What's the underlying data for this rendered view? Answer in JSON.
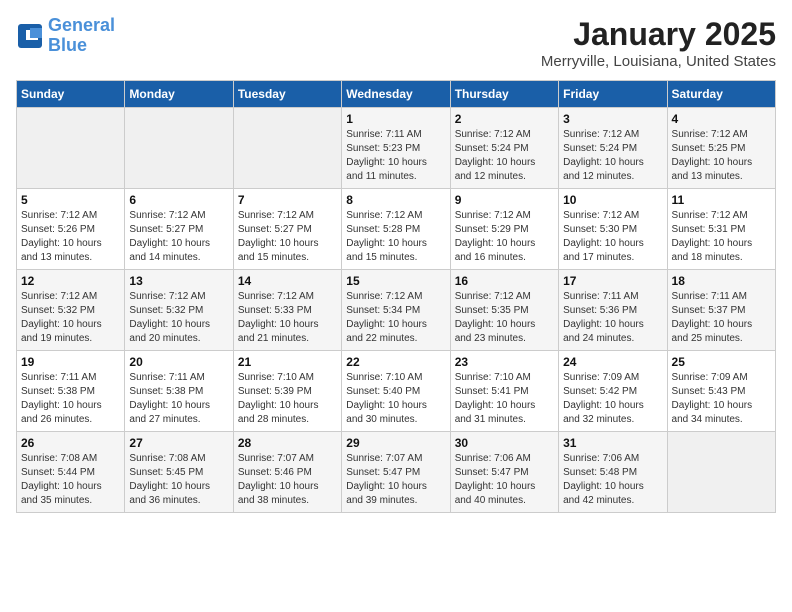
{
  "logo": {
    "text_general": "General",
    "text_blue": "Blue"
  },
  "title": "January 2025",
  "subtitle": "Merryville, Louisiana, United States",
  "days_of_week": [
    "Sunday",
    "Monday",
    "Tuesday",
    "Wednesday",
    "Thursday",
    "Friday",
    "Saturday"
  ],
  "weeks": [
    [
      {
        "day": "",
        "sunrise": "",
        "sunset": "",
        "daylight": ""
      },
      {
        "day": "",
        "sunrise": "",
        "sunset": "",
        "daylight": ""
      },
      {
        "day": "",
        "sunrise": "",
        "sunset": "",
        "daylight": ""
      },
      {
        "day": "1",
        "sunrise": "Sunrise: 7:11 AM",
        "sunset": "Sunset: 5:23 PM",
        "daylight": "Daylight: 10 hours and 11 minutes."
      },
      {
        "day": "2",
        "sunrise": "Sunrise: 7:12 AM",
        "sunset": "Sunset: 5:24 PM",
        "daylight": "Daylight: 10 hours and 12 minutes."
      },
      {
        "day": "3",
        "sunrise": "Sunrise: 7:12 AM",
        "sunset": "Sunset: 5:24 PM",
        "daylight": "Daylight: 10 hours and 12 minutes."
      },
      {
        "day": "4",
        "sunrise": "Sunrise: 7:12 AM",
        "sunset": "Sunset: 5:25 PM",
        "daylight": "Daylight: 10 hours and 13 minutes."
      }
    ],
    [
      {
        "day": "5",
        "sunrise": "Sunrise: 7:12 AM",
        "sunset": "Sunset: 5:26 PM",
        "daylight": "Daylight: 10 hours and 13 minutes."
      },
      {
        "day": "6",
        "sunrise": "Sunrise: 7:12 AM",
        "sunset": "Sunset: 5:27 PM",
        "daylight": "Daylight: 10 hours and 14 minutes."
      },
      {
        "day": "7",
        "sunrise": "Sunrise: 7:12 AM",
        "sunset": "Sunset: 5:27 PM",
        "daylight": "Daylight: 10 hours and 15 minutes."
      },
      {
        "day": "8",
        "sunrise": "Sunrise: 7:12 AM",
        "sunset": "Sunset: 5:28 PM",
        "daylight": "Daylight: 10 hours and 15 minutes."
      },
      {
        "day": "9",
        "sunrise": "Sunrise: 7:12 AM",
        "sunset": "Sunset: 5:29 PM",
        "daylight": "Daylight: 10 hours and 16 minutes."
      },
      {
        "day": "10",
        "sunrise": "Sunrise: 7:12 AM",
        "sunset": "Sunset: 5:30 PM",
        "daylight": "Daylight: 10 hours and 17 minutes."
      },
      {
        "day": "11",
        "sunrise": "Sunrise: 7:12 AM",
        "sunset": "Sunset: 5:31 PM",
        "daylight": "Daylight: 10 hours and 18 minutes."
      }
    ],
    [
      {
        "day": "12",
        "sunrise": "Sunrise: 7:12 AM",
        "sunset": "Sunset: 5:32 PM",
        "daylight": "Daylight: 10 hours and 19 minutes."
      },
      {
        "day": "13",
        "sunrise": "Sunrise: 7:12 AM",
        "sunset": "Sunset: 5:32 PM",
        "daylight": "Daylight: 10 hours and 20 minutes."
      },
      {
        "day": "14",
        "sunrise": "Sunrise: 7:12 AM",
        "sunset": "Sunset: 5:33 PM",
        "daylight": "Daylight: 10 hours and 21 minutes."
      },
      {
        "day": "15",
        "sunrise": "Sunrise: 7:12 AM",
        "sunset": "Sunset: 5:34 PM",
        "daylight": "Daylight: 10 hours and 22 minutes."
      },
      {
        "day": "16",
        "sunrise": "Sunrise: 7:12 AM",
        "sunset": "Sunset: 5:35 PM",
        "daylight": "Daylight: 10 hours and 23 minutes."
      },
      {
        "day": "17",
        "sunrise": "Sunrise: 7:11 AM",
        "sunset": "Sunset: 5:36 PM",
        "daylight": "Daylight: 10 hours and 24 minutes."
      },
      {
        "day": "18",
        "sunrise": "Sunrise: 7:11 AM",
        "sunset": "Sunset: 5:37 PM",
        "daylight": "Daylight: 10 hours and 25 minutes."
      }
    ],
    [
      {
        "day": "19",
        "sunrise": "Sunrise: 7:11 AM",
        "sunset": "Sunset: 5:38 PM",
        "daylight": "Daylight: 10 hours and 26 minutes."
      },
      {
        "day": "20",
        "sunrise": "Sunrise: 7:11 AM",
        "sunset": "Sunset: 5:38 PM",
        "daylight": "Daylight: 10 hours and 27 minutes."
      },
      {
        "day": "21",
        "sunrise": "Sunrise: 7:10 AM",
        "sunset": "Sunset: 5:39 PM",
        "daylight": "Daylight: 10 hours and 28 minutes."
      },
      {
        "day": "22",
        "sunrise": "Sunrise: 7:10 AM",
        "sunset": "Sunset: 5:40 PM",
        "daylight": "Daylight: 10 hours and 30 minutes."
      },
      {
        "day": "23",
        "sunrise": "Sunrise: 7:10 AM",
        "sunset": "Sunset: 5:41 PM",
        "daylight": "Daylight: 10 hours and 31 minutes."
      },
      {
        "day": "24",
        "sunrise": "Sunrise: 7:09 AM",
        "sunset": "Sunset: 5:42 PM",
        "daylight": "Daylight: 10 hours and 32 minutes."
      },
      {
        "day": "25",
        "sunrise": "Sunrise: 7:09 AM",
        "sunset": "Sunset: 5:43 PM",
        "daylight": "Daylight: 10 hours and 34 minutes."
      }
    ],
    [
      {
        "day": "26",
        "sunrise": "Sunrise: 7:08 AM",
        "sunset": "Sunset: 5:44 PM",
        "daylight": "Daylight: 10 hours and 35 minutes."
      },
      {
        "day": "27",
        "sunrise": "Sunrise: 7:08 AM",
        "sunset": "Sunset: 5:45 PM",
        "daylight": "Daylight: 10 hours and 36 minutes."
      },
      {
        "day": "28",
        "sunrise": "Sunrise: 7:07 AM",
        "sunset": "Sunset: 5:46 PM",
        "daylight": "Daylight: 10 hours and 38 minutes."
      },
      {
        "day": "29",
        "sunrise": "Sunrise: 7:07 AM",
        "sunset": "Sunset: 5:47 PM",
        "daylight": "Daylight: 10 hours and 39 minutes."
      },
      {
        "day": "30",
        "sunrise": "Sunrise: 7:06 AM",
        "sunset": "Sunset: 5:47 PM",
        "daylight": "Daylight: 10 hours and 40 minutes."
      },
      {
        "day": "31",
        "sunrise": "Sunrise: 7:06 AM",
        "sunset": "Sunset: 5:48 PM",
        "daylight": "Daylight: 10 hours and 42 minutes."
      },
      {
        "day": "",
        "sunrise": "",
        "sunset": "",
        "daylight": ""
      }
    ]
  ]
}
